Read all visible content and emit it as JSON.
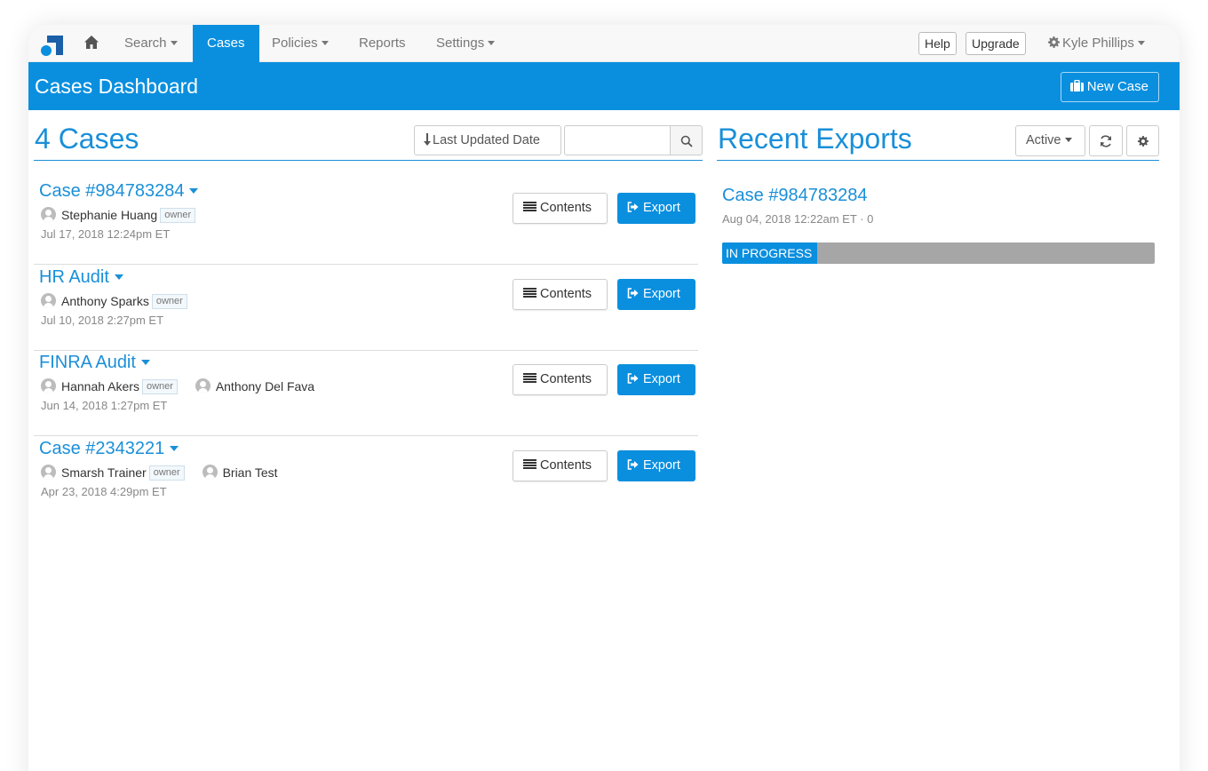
{
  "nav": {
    "items": [
      {
        "label": "Search",
        "has_caret": true,
        "active": false
      },
      {
        "label": "Cases",
        "has_caret": false,
        "active": true
      },
      {
        "label": "Policies",
        "has_caret": true,
        "active": false
      },
      {
        "label": "Reports",
        "has_caret": false,
        "active": false
      },
      {
        "label": "Settings",
        "has_caret": true,
        "active": false
      }
    ],
    "help_label": "Help",
    "upgrade_label": "Upgrade",
    "user_name": "Kyle Phillips",
    "icons": {
      "logo": "brand-logo",
      "home": "home-icon",
      "user_menu": "gear-icon"
    }
  },
  "header": {
    "title": "Cases Dashboard",
    "new_case_label": "New Case"
  },
  "cases_panel": {
    "heading": "4 Cases",
    "sort_label": "Last Updated Date",
    "search_value": "",
    "contents_label": "Contents",
    "export_label": "Export",
    "owner_tag": "owner",
    "cases": [
      {
        "title": "Case #984783284",
        "people": [
          {
            "name": "Stephanie Huang",
            "owner": true
          }
        ],
        "date": "Jul 17, 2018 12:24pm ET"
      },
      {
        "title": "HR Audit",
        "people": [
          {
            "name": "Anthony Sparks",
            "owner": true
          }
        ],
        "date": "Jul 10, 2018 2:27pm ET"
      },
      {
        "title": "FINRA Audit",
        "people": [
          {
            "name": "Hannah Akers",
            "owner": true
          },
          {
            "name": "Anthony Del Fava",
            "owner": false
          }
        ],
        "date": "Jun 14, 2018 1:27pm ET"
      },
      {
        "title": "Case #2343221",
        "people": [
          {
            "name": "Smarsh Trainer",
            "owner": true
          },
          {
            "name": "Brian Test",
            "owner": false
          }
        ],
        "date": "Apr 23, 2018 4:29pm ET"
      }
    ]
  },
  "exports_panel": {
    "heading": "Recent Exports",
    "filter_label": "Active",
    "exports": [
      {
        "title": "Case #984783284",
        "meta": "Aug 04, 2018 12:22am ET · 0",
        "status": "IN PROGRESS",
        "progress": 0.22
      }
    ]
  },
  "colors": {
    "accent": "#0a8fdf",
    "link": "#1a8fd8",
    "progress_track": "#a6a6a6"
  }
}
